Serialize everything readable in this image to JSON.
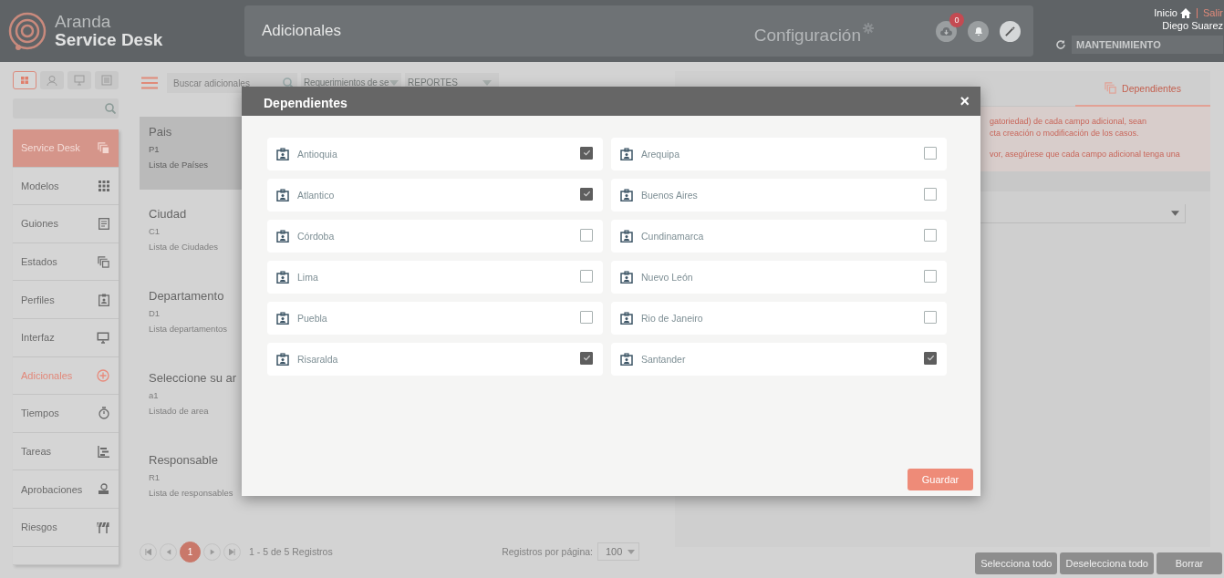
{
  "header": {
    "brand_top": "Aranda",
    "brand_bottom": "Service Desk",
    "page_title": "Adicionales",
    "config_label": "Configuración",
    "notification_count": "0",
    "home_link": "Inicio",
    "logout_link": "Salir",
    "user_name": "Diego Suarez",
    "project_field": "MANTENIMIENTO"
  },
  "tool_buttons": [
    {
      "selected": true
    },
    {
      "selected": false
    },
    {
      "selected": false
    },
    {
      "selected": false
    }
  ],
  "sidebar": {
    "items": [
      {
        "label": "Service Desk",
        "kind": "group",
        "selected": false
      },
      {
        "label": "Modelos",
        "kind": "item",
        "selected": false
      },
      {
        "label": "Guiones",
        "kind": "item",
        "selected": false
      },
      {
        "label": "Estados",
        "kind": "item",
        "selected": false
      },
      {
        "label": "Perfiles",
        "kind": "item",
        "selected": false
      },
      {
        "label": "Interfaz",
        "kind": "item",
        "selected": false
      },
      {
        "label": "Adicionales",
        "kind": "item",
        "selected": true
      },
      {
        "label": "Tiempos",
        "kind": "item",
        "selected": false
      },
      {
        "label": "Tareas",
        "kind": "item",
        "selected": false
      },
      {
        "label": "Aprobaciones",
        "kind": "item",
        "selected": false
      },
      {
        "label": "Riesgos",
        "kind": "item",
        "selected": false
      }
    ]
  },
  "list": {
    "search_placeholder": "Buscar adicionales",
    "filter_1": "Requerimientos de se",
    "filter_2": "REPORTES",
    "cards": [
      {
        "title": "Pais",
        "code": "P1",
        "description": "Lista de Países",
        "selected": true
      },
      {
        "title": "Ciudad",
        "code": "C1",
        "description": "Lista de Ciudades",
        "selected": false
      },
      {
        "title": "Departamento",
        "code": "D1",
        "description": "Lista departamentos",
        "selected": false
      },
      {
        "title": "Seleccione su ar",
        "code": "a1",
        "description": "Listado de area",
        "selected": false
      },
      {
        "title": "Responsable",
        "code": "R1",
        "description": "Lista de responsables",
        "selected": false
      }
    ],
    "pagination": {
      "current_page": "1",
      "summary": "1 - 5 de 5 Registros",
      "per_page_label": "Registros por página:",
      "per_page": "100"
    }
  },
  "detail": {
    "active_tab": "Dependientes",
    "message_lines": [
      "gatoriedad) de cada campo adicional, sean",
      "cta creación o modificación de los casos.",
      "vor, asegúrese que cada campo adicional tenga una"
    ],
    "buttons": [
      "Selecciona todo",
      "Deselecciona todo",
      "Borrar"
    ]
  },
  "dialog": {
    "title": "Dependientes",
    "close": "×",
    "items": [
      {
        "label": "Antioquia",
        "checked": true
      },
      {
        "label": "Arequipa",
        "checked": false
      },
      {
        "label": "Atlantico",
        "checked": true
      },
      {
        "label": "Buenos Aires",
        "checked": false
      },
      {
        "label": "Córdoba",
        "checked": false
      },
      {
        "label": "Cundinamarca",
        "checked": false
      },
      {
        "label": "Lima",
        "checked": false
      },
      {
        "label": "Nuevo León",
        "checked": false
      },
      {
        "label": "Puebla",
        "checked": false
      },
      {
        "label": "Rio de Janeiro",
        "checked": false
      },
      {
        "label": "Risaralda",
        "checked": true
      },
      {
        "label": "Santander",
        "checked": true
      }
    ],
    "save_button": "Guardar"
  }
}
